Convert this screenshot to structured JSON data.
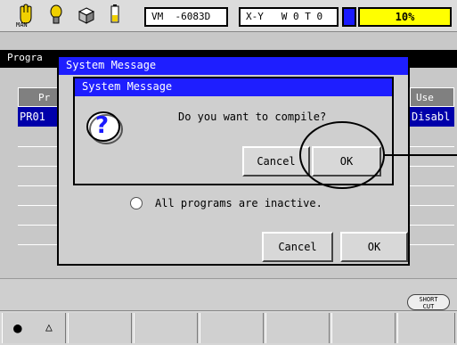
{
  "toolbar": {
    "mode_label": "MAN",
    "position_box": "VM  -6083D",
    "axis_box": "X-Y   W 0 T 0",
    "progress_label": "10%",
    "progress": 0.1
  },
  "program_bar": {
    "title": "Progra"
  },
  "table": {
    "partial_header_left": "Pr",
    "header_use": "Use",
    "row1_name": "PR01",
    "row1_use": "Disabl"
  },
  "outer_dialog": {
    "title": "System Message",
    "message": "All programs are inactive.",
    "cancel_label": "Cancel",
    "ok_label": "OK"
  },
  "inner_dialog": {
    "title": "System Message",
    "message": "Do you want to compile?",
    "question_icon": "?",
    "cancel_label": "Cancel",
    "ok_label": "OK"
  },
  "shortcut": {
    "label_top": "SHORT",
    "label_bottom": "CUT"
  },
  "bottom_bar": {
    "dot_glyph": "●",
    "triangle_glyph": "△"
  },
  "colors": {
    "title_blue": "#1e1eff",
    "select_blue": "#0000aa",
    "progress_yellow": "#ffff00"
  }
}
